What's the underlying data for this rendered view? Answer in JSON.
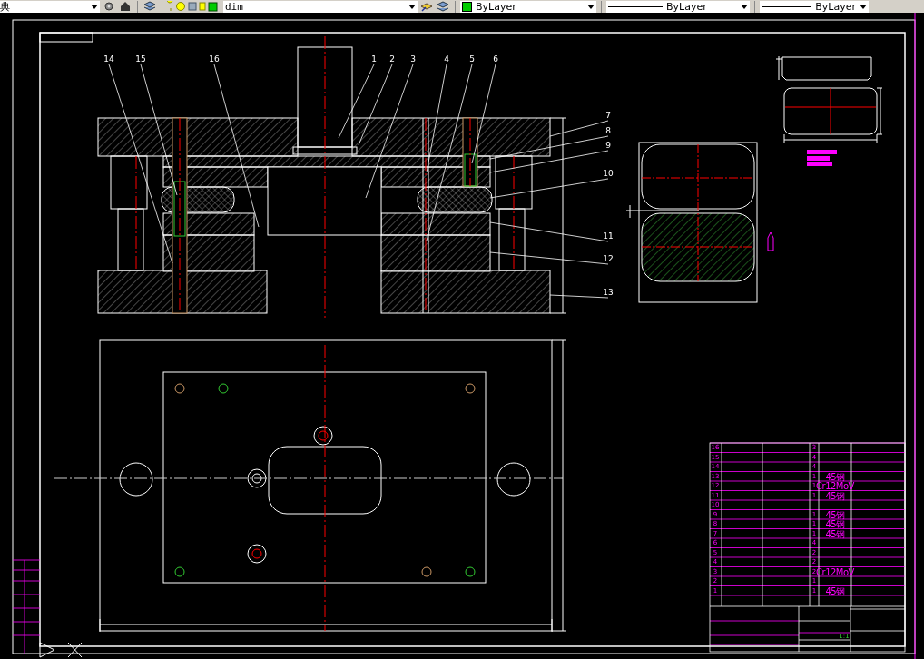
{
  "toolbar": {
    "workspace": "典",
    "layer": "dim",
    "color_control": "ByLayer",
    "linetype": "ByLayer",
    "lineweight": "ByLayer"
  },
  "part_labels": [
    "14",
    "15",
    "16",
    "1",
    "2",
    "3",
    "4",
    "5",
    "6",
    "7",
    "8",
    "9",
    "10",
    "11",
    "12",
    "13"
  ],
  "parts_list": {
    "rows": [
      {
        "no": "16",
        "qty": "3"
      },
      {
        "no": "15",
        "qty": "4"
      },
      {
        "no": "14",
        "qty": "4"
      },
      {
        "no": "13",
        "qty": "1",
        "material": "45钢"
      },
      {
        "no": "12",
        "qty": "1",
        "material": "Cr12MoV"
      },
      {
        "no": "11",
        "qty": "1",
        "material": "45钢"
      },
      {
        "no": "10"
      },
      {
        "no": "9",
        "qty": "1",
        "material": "45钢"
      },
      {
        "no": "8",
        "qty": "1",
        "material": "45钢"
      },
      {
        "no": "7",
        "qty": "1",
        "material": "45钢"
      },
      {
        "no": "6",
        "qty": "4"
      },
      {
        "no": "5",
        "qty": "2"
      },
      {
        "no": "4",
        "qty": "2"
      },
      {
        "no": "3",
        "qty": "2",
        "material": "Cr12MoV"
      },
      {
        "no": "2",
        "qty": "1"
      },
      {
        "no": "1",
        "qty": "1",
        "material": "45钢"
      }
    ]
  },
  "title_block": {
    "scale": "1:1"
  }
}
